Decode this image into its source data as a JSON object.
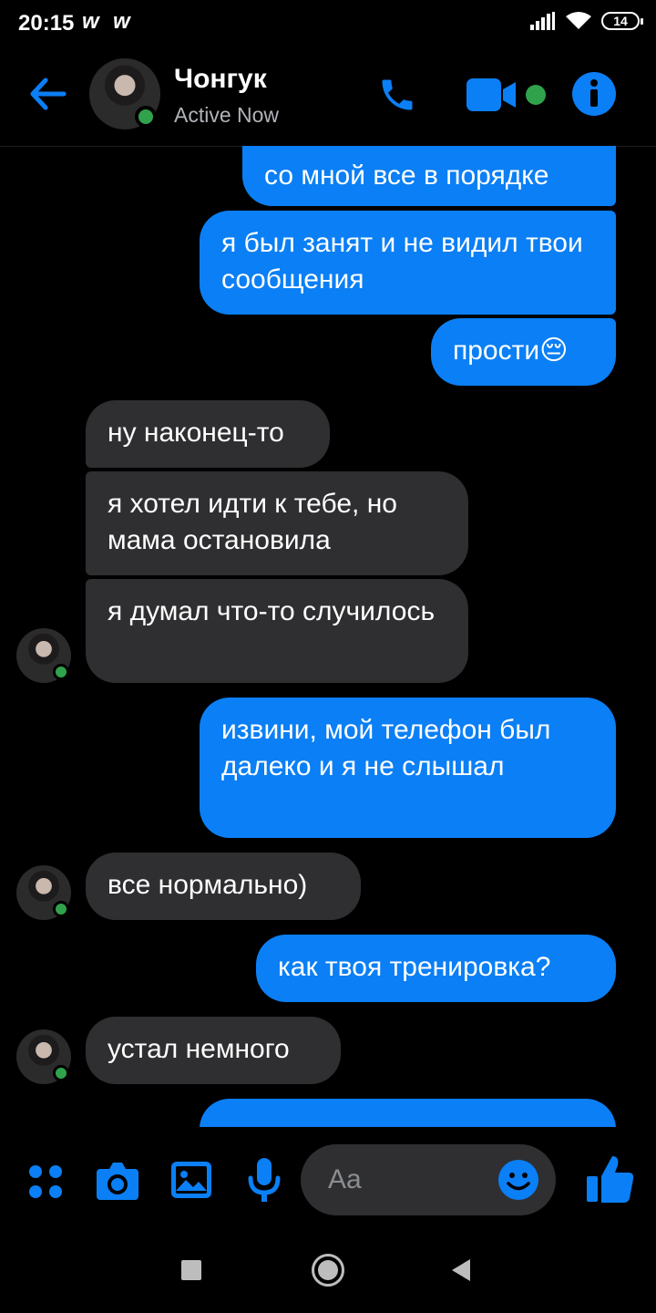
{
  "status_bar": {
    "time": "20:15",
    "app_glyph": "w",
    "battery": "14"
  },
  "header": {
    "contact_name": "Чонгук",
    "status": "Active Now"
  },
  "messages": [
    {
      "dir": "out",
      "text": "со мной все в порядке"
    },
    {
      "dir": "out",
      "text": "я был занят и не видил твои сообщения"
    },
    {
      "dir": "out",
      "text": "прости😔"
    },
    {
      "dir": "in",
      "text": "ну наконец-то"
    },
    {
      "dir": "in",
      "text": "я хотел идти к тебе, но мама остановила"
    },
    {
      "dir": "in",
      "text": "я думал что-то случилось"
    },
    {
      "dir": "out",
      "text": "извини, мой телефон был далеко и я не слышал"
    },
    {
      "dir": "in",
      "text": "все нормально)"
    },
    {
      "dir": "out",
      "text": "как твоя тренировка?"
    },
    {
      "dir": "in",
      "text": "устал немного"
    }
  ],
  "composer": {
    "placeholder": "Aa"
  },
  "colors": {
    "accent": "#0b7ff5",
    "online": "#31a24c",
    "incoming_bubble": "#2f2f31"
  }
}
